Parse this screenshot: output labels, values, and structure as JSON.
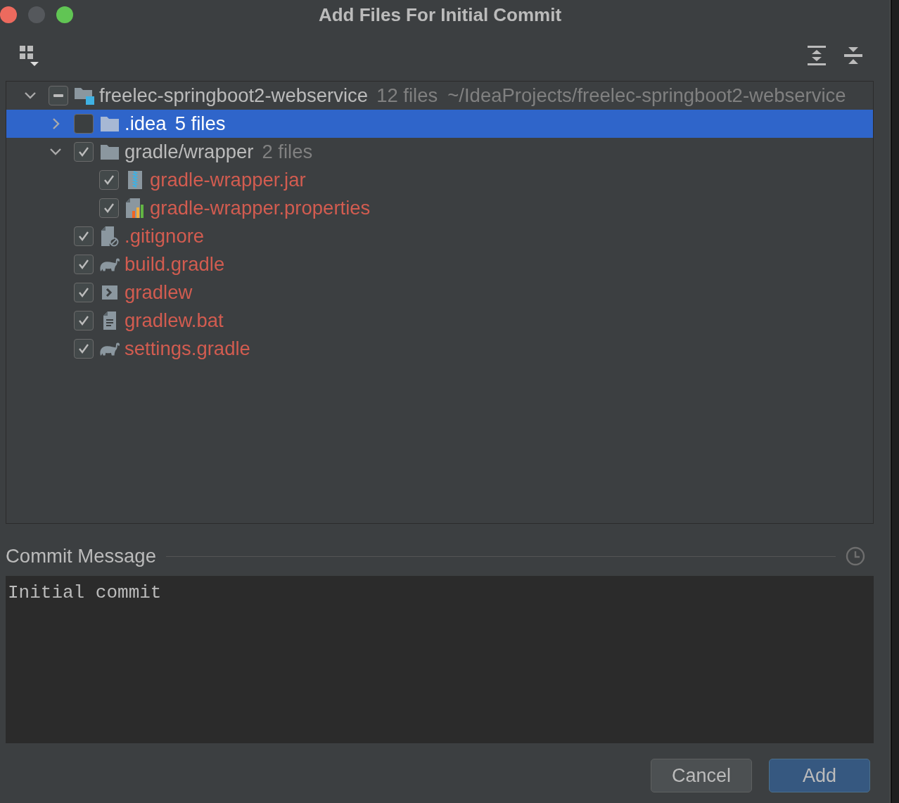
{
  "window": {
    "title": "Add Files For Initial Commit"
  },
  "files": [
    {
      "kind": "module",
      "name": "freelec-springboot2-webservice",
      "count": "12 files",
      "path": "~/IdeaProjects/freelec-springboot2-webservice",
      "indeterminate": true,
      "selected": false,
      "expanded": true,
      "children": [
        {
          "kind": "folder",
          "name": ".idea",
          "count": "5 files",
          "checked": false,
          "selected": true,
          "expanded": false
        },
        {
          "kind": "folder",
          "name": "gradle/wrapper",
          "count": "2 files",
          "checked": true,
          "selected": false,
          "expanded": true,
          "children": [
            {
              "kind": "archive",
              "name": "gradle-wrapper.jar",
              "checked": true,
              "selected": false
            },
            {
              "kind": "properties",
              "name": "gradle-wrapper.properties",
              "checked": true,
              "selected": false
            }
          ]
        },
        {
          "kind": "ignore",
          "name": ".gitignore",
          "checked": true,
          "selected": false
        },
        {
          "kind": "gradle",
          "name": "build.gradle",
          "checked": true,
          "selected": false
        },
        {
          "kind": "shell",
          "name": "gradlew",
          "checked": true,
          "selected": false
        },
        {
          "kind": "text",
          "name": "gradlew.bat",
          "checked": true,
          "selected": false
        },
        {
          "kind": "gradle",
          "name": "settings.gradle",
          "checked": true,
          "selected": false
        }
      ]
    }
  ],
  "commit_message": {
    "label": "Commit Message",
    "value": "Initial commit"
  },
  "buttons": [
    {
      "label": "Cancel",
      "kind": "secondary"
    },
    {
      "label": "Add",
      "kind": "primary"
    }
  ]
}
